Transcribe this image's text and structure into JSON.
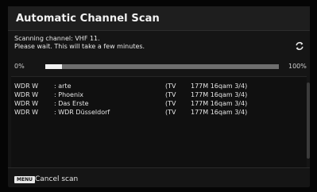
{
  "window": {
    "title": "Automatic Channel Scan"
  },
  "status": {
    "scanning": "Scanning channel: VHF 11.",
    "wait": "Please wait. This will take a few minutes."
  },
  "progress": {
    "min_label": "0%",
    "max_label": "100%",
    "fraction": 0.07
  },
  "icons": {
    "refresh": "refresh-icon"
  },
  "channels": [
    {
      "source": "WDR W",
      "name": ": arte",
      "type": "(TV",
      "info": "177M 16qam 3/4)"
    },
    {
      "source": "WDR W",
      "name": ": Phoenix",
      "type": "(TV",
      "info": "177M 16qam 3/4)"
    },
    {
      "source": "WDR W",
      "name": ": Das Erste",
      "type": "(TV",
      "info": "177M 16qam 3/4)"
    },
    {
      "source": "WDR W",
      "name": ": WDR Düsseldorf",
      "type": "(TV",
      "info": "177M 16qam 3/4)"
    }
  ],
  "footer": {
    "key": "MENU",
    "label": "Cancel scan"
  }
}
